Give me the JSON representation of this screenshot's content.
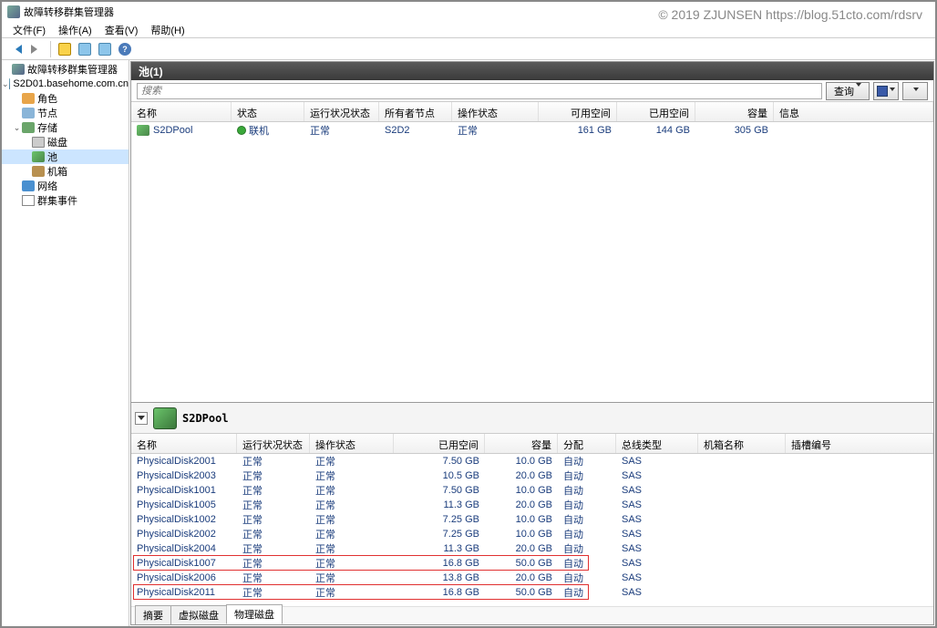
{
  "watermark": "© 2019 ZJUNSEN https://blog.51cto.com/rdsrv",
  "window_title": "故障转移群集管理器",
  "menu": {
    "file": "文件(F)",
    "action": "操作(A)",
    "view": "查看(V)",
    "help": "帮助(H)"
  },
  "tree": {
    "root": "故障转移群集管理器",
    "cluster": "S2D01.basehome.com.cn",
    "roles": "角色",
    "nodes": "节点",
    "storage": "存储",
    "disks": "磁盘",
    "pools": "池",
    "enclosures": "机箱",
    "networks": "网络",
    "events": "群集事件"
  },
  "content": {
    "header": "池(1)",
    "search_placeholder": "搜索",
    "query_btn": "查询"
  },
  "pool_cols": {
    "name": "名称",
    "status": "状态",
    "health": "运行状况状态",
    "owner": "所有者节点",
    "op_status": "操作状态",
    "free": "可用空间",
    "used": "已用空间",
    "capacity": "容量",
    "info": "信息"
  },
  "pool_row": {
    "name": "S2DPool",
    "status": "联机",
    "health": "正常",
    "owner": "S2D2",
    "op_status": "正常",
    "free": "161 GB",
    "used": "144 GB",
    "capacity": "305 GB"
  },
  "detail_title": "S2DPool",
  "disk_cols": {
    "name": "名称",
    "health": "运行状况状态",
    "op_status": "操作状态",
    "used": "已用空间",
    "capacity": "容量",
    "alloc": "分配",
    "bus": "总线类型",
    "chassis": "机箱名称",
    "slot": "插槽编号"
  },
  "disks": [
    {
      "name": "PhysicalDisk2001",
      "health": "正常",
      "op": "正常",
      "used": "7.50 GB",
      "cap": "10.0 GB",
      "alloc": "自动",
      "bus": "SAS"
    },
    {
      "name": "PhysicalDisk2003",
      "health": "正常",
      "op": "正常",
      "used": "10.5 GB",
      "cap": "20.0 GB",
      "alloc": "自动",
      "bus": "SAS"
    },
    {
      "name": "PhysicalDisk1001",
      "health": "正常",
      "op": "正常",
      "used": "7.50 GB",
      "cap": "10.0 GB",
      "alloc": "自动",
      "bus": "SAS"
    },
    {
      "name": "PhysicalDisk1005",
      "health": "正常",
      "op": "正常",
      "used": "11.3 GB",
      "cap": "20.0 GB",
      "alloc": "自动",
      "bus": "SAS"
    },
    {
      "name": "PhysicalDisk1002",
      "health": "正常",
      "op": "正常",
      "used": "7.25 GB",
      "cap": "10.0 GB",
      "alloc": "自动",
      "bus": "SAS"
    },
    {
      "name": "PhysicalDisk2002",
      "health": "正常",
      "op": "正常",
      "used": "7.25 GB",
      "cap": "10.0 GB",
      "alloc": "自动",
      "bus": "SAS"
    },
    {
      "name": "PhysicalDisk2004",
      "health": "正常",
      "op": "正常",
      "used": "11.3 GB",
      "cap": "20.0 GB",
      "alloc": "自动",
      "bus": "SAS"
    },
    {
      "name": "PhysicalDisk1007",
      "health": "正常",
      "op": "正常",
      "used": "16.8 GB",
      "cap": "50.0 GB",
      "alloc": "自动",
      "bus": "SAS"
    },
    {
      "name": "PhysicalDisk2006",
      "health": "正常",
      "op": "正常",
      "used": "13.8 GB",
      "cap": "20.0 GB",
      "alloc": "自动",
      "bus": "SAS"
    },
    {
      "name": "PhysicalDisk2011",
      "health": "正常",
      "op": "正常",
      "used": "16.8 GB",
      "cap": "50.0 GB",
      "alloc": "自动",
      "bus": "SAS"
    }
  ],
  "tabs": {
    "summary": "摘要",
    "vdisks": "虚拟磁盘",
    "pdisks": "物理磁盘"
  }
}
